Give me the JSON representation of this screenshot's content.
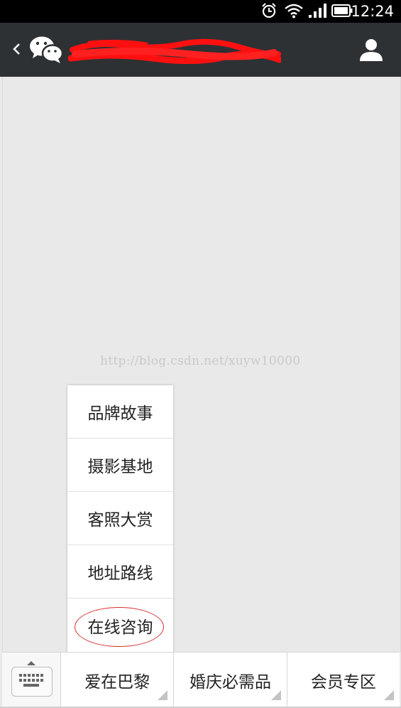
{
  "status_bar": {
    "time": "12:24",
    "icons": [
      "alarm-icon",
      "wifi-icon",
      "signal-icon",
      "battery-icon"
    ]
  },
  "header": {
    "back_icon": "chevron-left-icon",
    "logo_icon": "wechat-logo-icon",
    "title": "",
    "profile_icon": "person-icon",
    "background_color": "#2d3134",
    "redaction_color": "#ff0000"
  },
  "chat": {
    "watermark": "http://blog.csdn.net/xuyw10000",
    "background_color": "#e9e9e9"
  },
  "submenu": {
    "items": [
      {
        "label": "品牌故事"
      },
      {
        "label": "摄影基地"
      },
      {
        "label": "客照大赏"
      },
      {
        "label": "地址路线"
      },
      {
        "label": "在线咨询",
        "circled": true
      }
    ],
    "highlight_color": "#d53030"
  },
  "bottom_menu": {
    "keyboard_icon": "keyboard-icon",
    "buttons": [
      {
        "label": "爱在巴黎"
      },
      {
        "label": "婚庆必需品"
      },
      {
        "label": "会员专区"
      }
    ]
  }
}
